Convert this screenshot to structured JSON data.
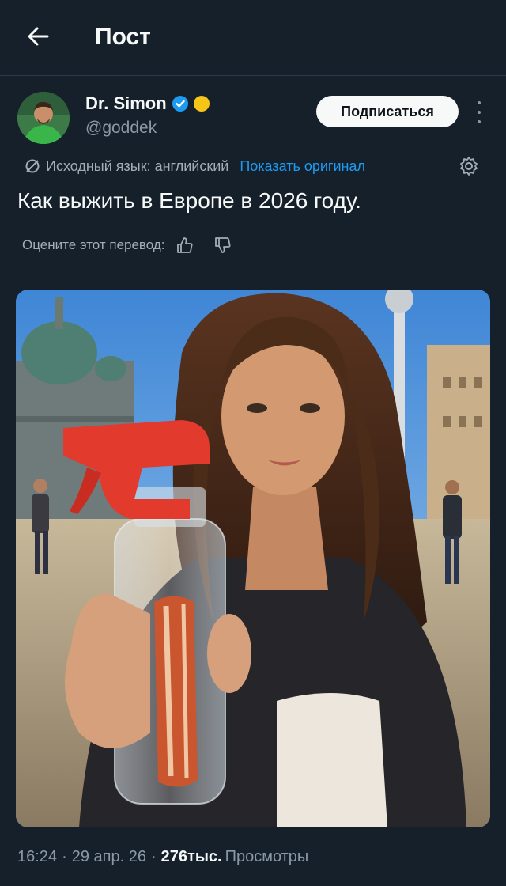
{
  "header": {
    "title": "Пост",
    "back_icon": "arrow-left-icon"
  },
  "author": {
    "name": "Dr. Simon",
    "handle": "@goddek",
    "follow_label": "Подписаться",
    "badges": [
      "verified-badge-icon",
      "gold-coin-icon"
    ]
  },
  "translation": {
    "source_language": "Исходный язык: английский",
    "show_original": "Показать оригинал"
  },
  "post": {
    "text": "Как выжить в Европе в 2026 году.",
    "rate_prompt": "Оцените этот перевод:"
  },
  "meta": {
    "time": "16:24",
    "date": "29 апр. 26",
    "views_count": "276тыс.",
    "views_label": "Просмотры",
    "separator": "·"
  },
  "colors": {
    "background": "#15202b",
    "accent": "#1d9bf0",
    "muted": "#8b98a5",
    "text": "#f7f9f9"
  }
}
